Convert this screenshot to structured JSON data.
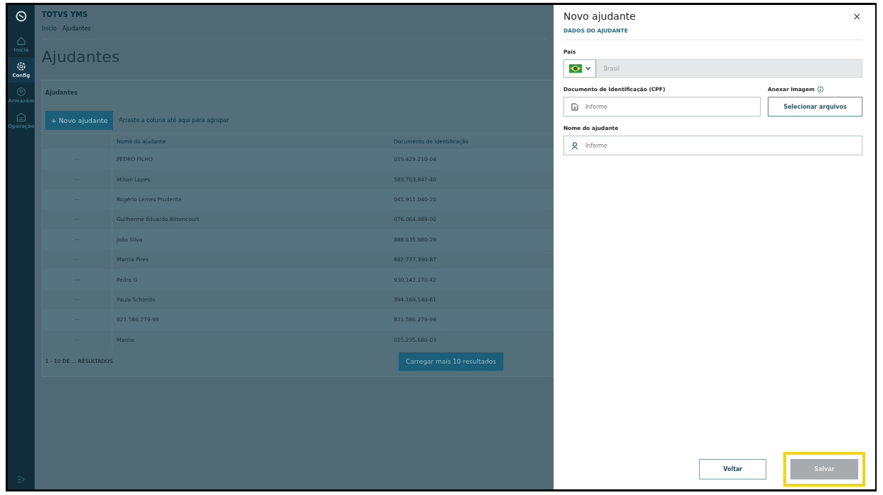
{
  "app": {
    "title": "TOTVS YMS"
  },
  "sidebar": {
    "items": [
      {
        "label": "Início",
        "selected": false
      },
      {
        "label": "Config",
        "selected": true
      },
      {
        "label": "Armazém",
        "selected": false
      },
      {
        "label": "Operação",
        "selected": false
      }
    ]
  },
  "breadcrumb": [
    "Início",
    "Ajudantes"
  ],
  "page_title": "Ajudantes",
  "card": {
    "title": "Ajudantes",
    "new_button": "+ Novo ajudante",
    "group_hint": "Arraste a coluna até aqui para agrupar",
    "table": {
      "columns": [
        "Nome do ajudante",
        "Documento de Identificação"
      ],
      "rows": [
        {
          "actions": "···",
          "name": "PEDRO FILHO",
          "document": "019.429.210-04"
        },
        {
          "actions": "···",
          "name": "Milton Lopes",
          "document": "583.763.847-40"
        },
        {
          "actions": "···",
          "name": "Rogério Lemes Prudente",
          "document": "041.911.040-20"
        },
        {
          "actions": "···",
          "name": "Guilherme Eduardo Bittencourt",
          "document": "076.064.389-00"
        },
        {
          "actions": "···",
          "name": "João Silva",
          "document": "888.635.980-29"
        },
        {
          "actions": "···",
          "name": "Marcia Pires",
          "document": "882.777.390-87"
        },
        {
          "actions": "···",
          "name": "Pedro G",
          "document": "930.142.170-42"
        },
        {
          "actions": "···",
          "name": "Paula Schimits",
          "document": "394.169.140-61"
        },
        {
          "actions": "···",
          "name": "821.586.279-99",
          "document": "821.586.279-99"
        },
        {
          "actions": "···",
          "name": "Marcio",
          "document": "015.235.680-03"
        }
      ]
    },
    "results": "1 - 10 DE ... RESULTADOS",
    "load_more": "Carregar mais 10 resultados"
  },
  "drawer": {
    "title": "Novo ajudante",
    "close": "×",
    "section": "DADOS DO AJUDANTE",
    "country": {
      "label": "País",
      "value": "Brasil",
      "disabled": true
    },
    "document": {
      "label": "Documento de Identificação (CPF)",
      "placeholder": "Informe"
    },
    "attach": {
      "label": "Anexar Imagem",
      "button": "Selecionar arquivos"
    },
    "name": {
      "label": "Nome do ajudante",
      "placeholder": "Informe"
    },
    "back_button": "Voltar",
    "save_button": {
      "label": "Salvar",
      "disabled": true,
      "highlighted": true
    }
  }
}
